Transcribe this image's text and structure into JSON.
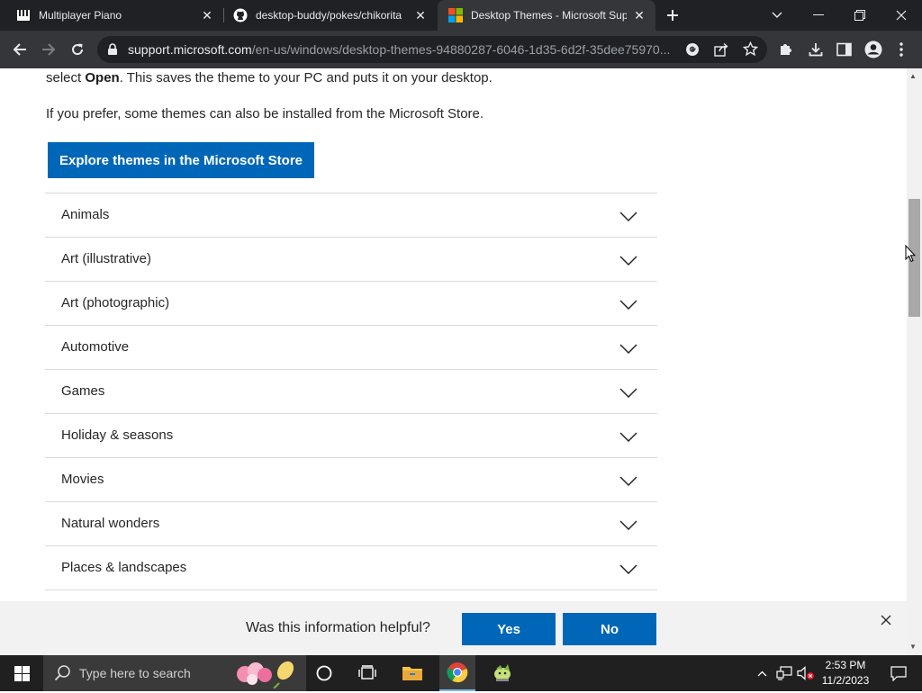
{
  "browser": {
    "tabs": [
      {
        "title": "Multiplayer Piano",
        "icon": "piano-icon",
        "active": false
      },
      {
        "title": "desktop-buddy/pokes/chikorita",
        "icon": "github-icon",
        "active": false
      },
      {
        "title": "Desktop Themes - Microsoft Support",
        "icon": "microsoft-icon",
        "active": true
      }
    ],
    "url_host": "support.microsoft.com",
    "url_path": "/en-us/windows/desktop-themes-94880287-6046-1d35-6d2f-35dee75970..."
  },
  "page": {
    "intro_prefix": "select ",
    "intro_bold": "Open",
    "intro_suffix": ". This saves the theme to your PC and puts it on your desktop.",
    "store_note": "If you prefer, some themes can also be installed from the Microsoft Store.",
    "explore_button": "Explore themes in the Microsoft Store",
    "categories": [
      "Animals",
      "Art (illustrative)",
      "Art (photographic)",
      "Automotive",
      "Games",
      "Holiday & seasons",
      "Movies",
      "Natural wonders",
      "Places & landscapes"
    ]
  },
  "feedback": {
    "question": "Was this information helpful?",
    "yes": "Yes",
    "no": "No"
  },
  "taskbar": {
    "search_placeholder": "Type here to search",
    "time": "2:53 PM",
    "date": "11/2/2023"
  },
  "colors": {
    "accent": "#0067b8",
    "chrome_dark": "#202124",
    "chrome_toolbar": "#35363a"
  }
}
